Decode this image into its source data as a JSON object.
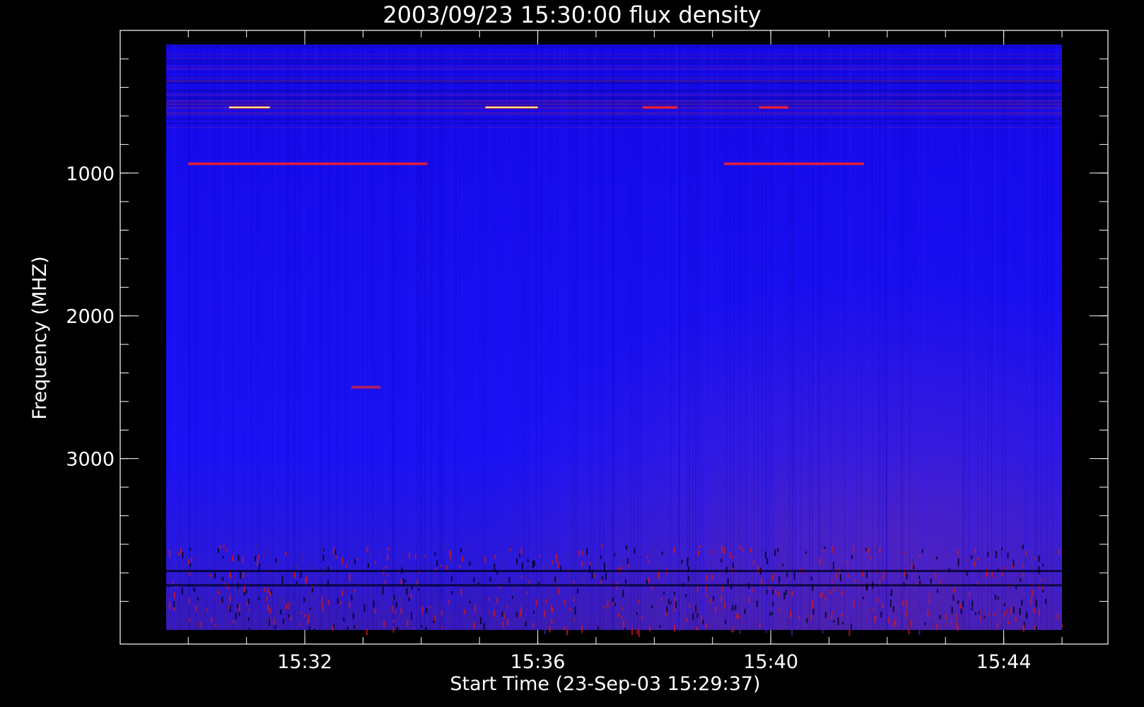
{
  "chart_data": {
    "type": "heatmap",
    "title": "2003/09/23 15:30:00 flux density",
    "xlabel": "Start Time (23-Sep-03 15:29:37)",
    "ylabel": "Frequency (MHZ)",
    "x_tick_labels": [
      "15:32",
      "15:36",
      "15:40",
      "15:44"
    ],
    "x_tick_values_minutes": [
      32,
      36,
      40,
      44
    ],
    "y_tick_labels": [
      "1000",
      "2000",
      "3000"
    ],
    "y_tick_values": [
      1000,
      2000,
      3000
    ],
    "xlim_minutes": [
      29.62,
      45.0
    ],
    "ylim_mhz": [
      4200,
      100
    ],
    "y_axis_inverted": true,
    "colormap": {
      "background": "#1a10f0",
      "low": "#000040",
      "high": "#ff2020",
      "peak": "#ffff80"
    },
    "features": [
      {
        "kind": "horizontal_band",
        "freq_mhz": 935,
        "t_start_minutes": 30.0,
        "t_end_minutes": 34.1,
        "intensity": "medium"
      },
      {
        "kind": "horizontal_band",
        "freq_mhz": 935,
        "t_start_minutes": 39.2,
        "t_end_minutes": 41.6,
        "intensity": "medium"
      },
      {
        "kind": "horizontal_band",
        "freq_mhz": 540,
        "t_start_minutes": 30.7,
        "t_end_minutes": 31.4,
        "intensity": "high"
      },
      {
        "kind": "horizontal_band",
        "freq_mhz": 540,
        "t_start_minutes": 35.1,
        "t_end_minutes": 36.0,
        "intensity": "high"
      },
      {
        "kind": "horizontal_band",
        "freq_mhz": 540,
        "t_start_minutes": 37.8,
        "t_end_minutes": 38.4,
        "intensity": "medium"
      },
      {
        "kind": "horizontal_band",
        "freq_mhz": 540,
        "t_start_minutes": 39.8,
        "t_end_minutes": 40.3,
        "intensity": "medium"
      },
      {
        "kind": "horizontal_band",
        "freq_mhz": 2500,
        "t_start_minutes": 32.8,
        "t_end_minutes": 33.3,
        "intensity": "low"
      },
      {
        "kind": "noise_region",
        "freq_from_mhz": 3600,
        "freq_to_mhz": 4200,
        "intensity": "medium"
      }
    ]
  }
}
